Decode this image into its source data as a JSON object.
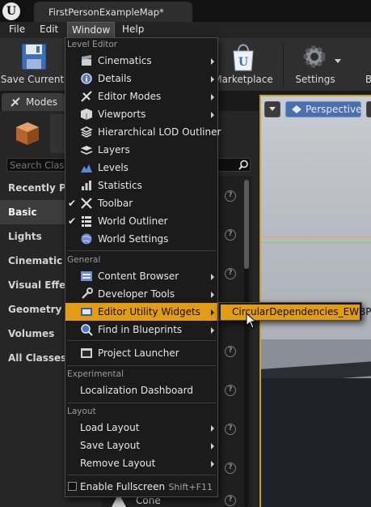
{
  "title_bar": {
    "logo": "unreal-logo",
    "tab_title": "FirstPersonExampleMap*"
  },
  "menubar": {
    "items": [
      "File",
      "Edit",
      "Window",
      "Help"
    ],
    "active": "Window"
  },
  "toolbar": {
    "buttons": [
      "Save Current",
      "Marketplace",
      "Settings"
    ],
    "truncated_button": "B"
  },
  "modes_tab": {
    "label": "Modes"
  },
  "left_panel": {
    "search_placeholder": "Search Classes",
    "categories": [
      "Recently Placed",
      "Basic",
      "Lights",
      "Cinematic",
      "Visual Effects",
      "Geometry",
      "Volumes",
      "All Classes"
    ],
    "selected_category": "Basic",
    "visible_item": "Cone"
  },
  "viewport": {
    "perspective_label": "Perspective"
  },
  "window_menu": {
    "sections": {
      "level_editor": "Level Editor",
      "general": "General",
      "experimental": "Experimental",
      "layout": "Layout"
    },
    "level_editor_items": [
      {
        "label": "Cinematics",
        "icon": "clapperboard-icon",
        "submenu": true
      },
      {
        "label": "Details",
        "icon": "magnifier-icon",
        "submenu": true
      },
      {
        "label": "Editor Modes",
        "icon": "modes-icon",
        "submenu": true
      },
      {
        "label": "Viewports",
        "icon": "viewport-icon",
        "submenu": true
      },
      {
        "label": "Hierarchical LOD Outliner",
        "icon": "lod-icon",
        "submenu": false
      },
      {
        "label": "Layers",
        "icon": "layers-icon",
        "submenu": false
      },
      {
        "label": "Levels",
        "icon": "levels-icon",
        "submenu": false
      },
      {
        "label": "Statistics",
        "icon": "statistics-icon",
        "submenu": false
      },
      {
        "label": "Toolbar",
        "icon": "tools-icon",
        "submenu": false,
        "checked": true
      },
      {
        "label": "World Outliner",
        "icon": "outliner-icon",
        "submenu": false,
        "checked": true
      },
      {
        "label": "World Settings",
        "icon": "globe-icon",
        "submenu": false
      }
    ],
    "general_items": [
      {
        "label": "Content Browser",
        "icon": "content-browser-icon",
        "submenu": true
      },
      {
        "label": "Developer Tools",
        "icon": "developer-tools-icon",
        "submenu": true
      },
      {
        "label": "Editor Utility Widgets",
        "icon": "widget-icon",
        "submenu": true,
        "highlighted": true
      },
      {
        "label": "Find in Blueprints",
        "icon": "find-blueprint-icon",
        "submenu": true
      },
      {
        "label": "Project Launcher",
        "icon": "launcher-icon",
        "submenu": false
      }
    ],
    "experimental_items": [
      {
        "label": "Localization Dashboard"
      }
    ],
    "layout_items": [
      {
        "label": "Load Layout",
        "submenu": true
      },
      {
        "label": "Save Layout",
        "submenu": true
      },
      {
        "label": "Remove Layout",
        "submenu": true
      }
    ],
    "fullscreen": {
      "label": "Enable Fullscreen",
      "shortcut": "Shift+F11",
      "checked": false
    }
  },
  "submenu": {
    "item": "CircularDependencies_EWBP"
  },
  "colors": {
    "highlight": "#e49c14",
    "viewport_border": "#c8a032"
  }
}
